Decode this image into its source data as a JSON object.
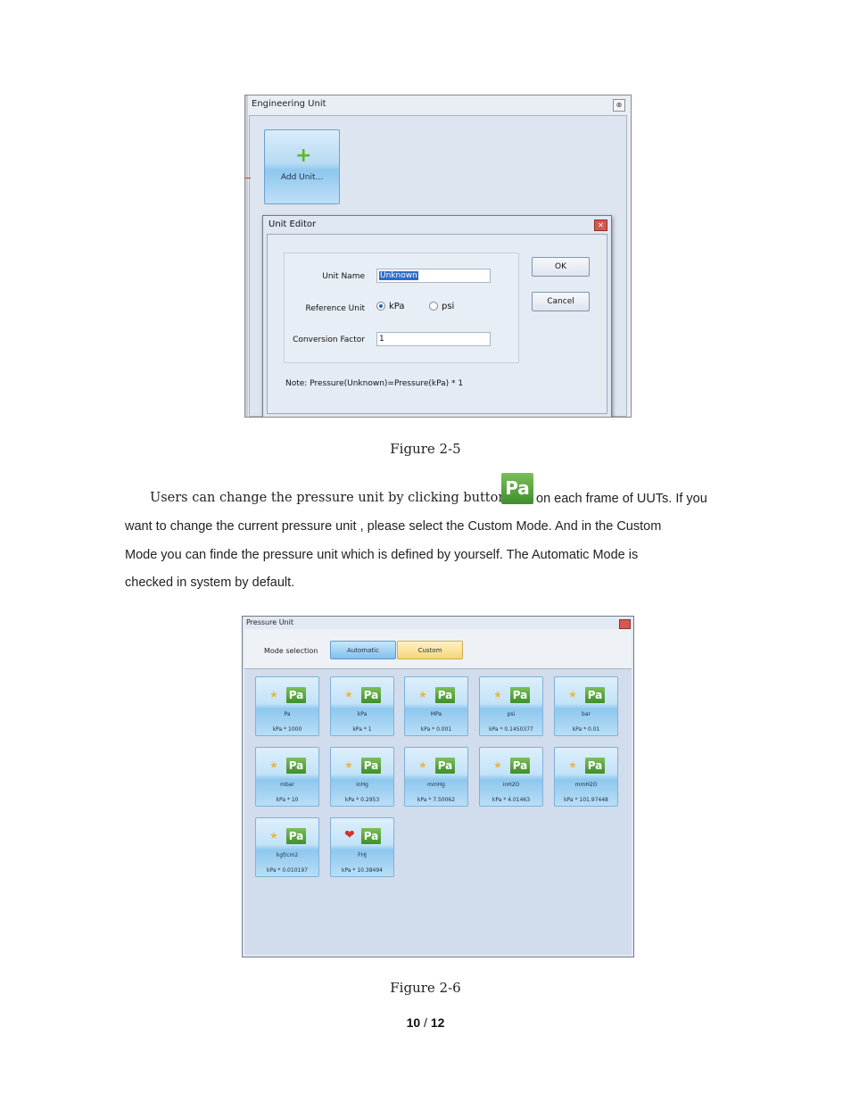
{
  "figure1": {
    "window_title": "Engineering Unit",
    "add_unit_label": "Add Unit...",
    "editor": {
      "title": "Unit Editor",
      "unit_name_label": "Unit Name",
      "unit_name_value": "Unknown",
      "reference_unit_label": "Reference Unit",
      "radio_kpa": "kPa",
      "radio_psi": "psi",
      "selected_reference": "kPa",
      "conversion_factor_label": "Conversion Factor",
      "conversion_factor_value": "1",
      "ok_label": "OK",
      "cancel_label": "Cancel",
      "note": "Note: Pressure(Unknown)=Pressure(kPa) * 1"
    },
    "caption": "Figure 2-5"
  },
  "paragraph": {
    "line1_a": "Users can change the pressure unit by clicking button",
    "icon_text": "Pa",
    "line1_b": "on each frame of UUTs. If you",
    "line2": "want to change the current pressure unit , please select the Custom Mode. And in the Custom",
    "line3": "Mode you can finde the pressure unit which is defined by yourself.  The Automatic Mode is",
    "line4": "checked in system by default."
  },
  "figure2": {
    "window_title": "Pressure Unit",
    "mode_label": "Mode selection",
    "mode_automatic": "Automatic",
    "mode_custom": "Custom",
    "tiles": [
      {
        "name": "Pa",
        "factor": "kPa * 1000",
        "icon": "star-icon"
      },
      {
        "name": "kPa",
        "factor": "kPa * 1",
        "icon": "star-icon"
      },
      {
        "name": "MPa",
        "factor": "kPa * 0.001",
        "icon": "star-icon"
      },
      {
        "name": "psi",
        "factor": "kPa * 0.1450377",
        "icon": "star-icon"
      },
      {
        "name": "bar",
        "factor": "kPa * 0.01",
        "icon": "star-icon"
      },
      {
        "name": "mbar",
        "factor": "kPa * 10",
        "icon": "star-icon"
      },
      {
        "name": "inHg",
        "factor": "kPa * 0.2953",
        "icon": "star-icon"
      },
      {
        "name": "mmHg",
        "factor": "kPa * 7.50062",
        "icon": "star-icon"
      },
      {
        "name": "inH2O",
        "factor": "kPa * 4.01463",
        "icon": "star-icon"
      },
      {
        "name": "mmH2O",
        "factor": "kPa * 101.97448",
        "icon": "star-icon"
      },
      {
        "name": "kgf/cm2",
        "factor": "kPa * 0.010197",
        "icon": "star-icon"
      },
      {
        "name": "FHJ",
        "factor": "kPa * 10.38494",
        "icon": "heart-icon"
      }
    ],
    "tile_icon_text": "Pa",
    "caption": "Figure 2-6"
  },
  "footer": {
    "page_current": "10",
    "page_sep": " / ",
    "page_total": "12"
  },
  "colors": {
    "accent_blue": "#8ec7ee",
    "custom_yellow": "#f6d57a",
    "pa_green": "#3e8f2a",
    "close_red": "#d45a4f"
  }
}
